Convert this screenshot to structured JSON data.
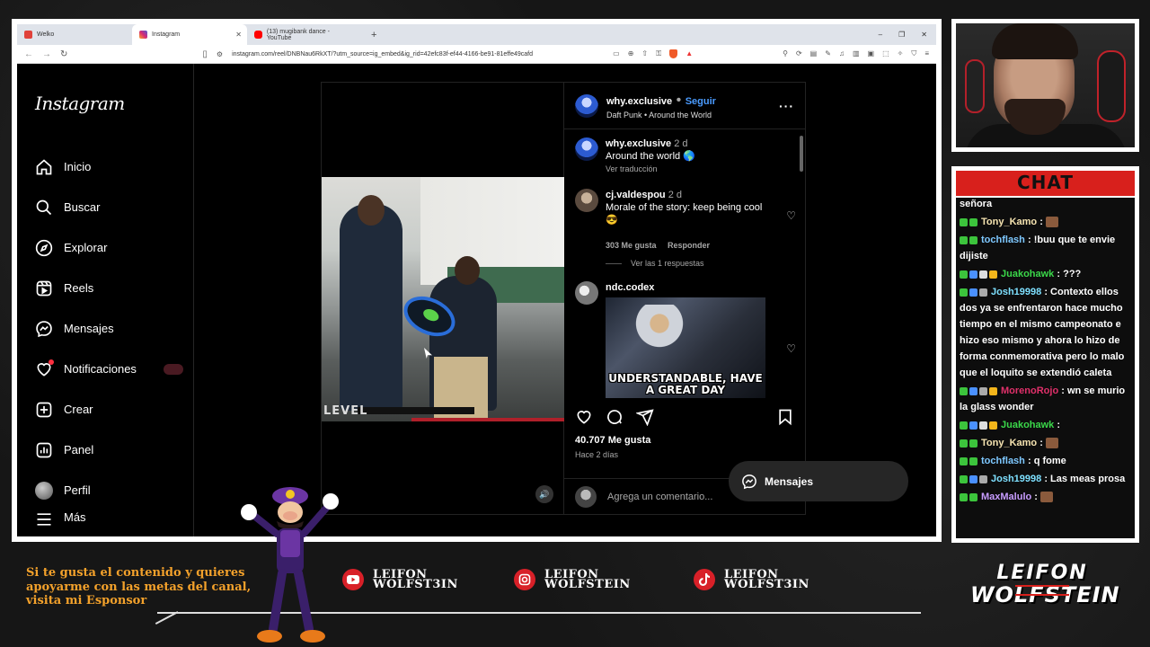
{
  "browser": {
    "tabs": [
      {
        "label": "Welko",
        "active": false,
        "icon": "vivaldi-icon",
        "color": "#e0413a"
      },
      {
        "label": "Instagram",
        "active": true,
        "icon": "instagram-icon",
        "color": "#d62976"
      },
      {
        "label": "(13) mugibank dance - YouTube",
        "active": false,
        "icon": "youtube-icon",
        "color": "#ff0000"
      }
    ],
    "new_tab": "+",
    "url": "instagram.com/reel/DNBNau6RkXT/?utm_source=ig_embed&ig_rid=42efc83f-ef44-4166-be91-81effe49cafd"
  },
  "instagram": {
    "logo": "Instagram",
    "nav": [
      {
        "label": "Inicio",
        "icon": "home-icon"
      },
      {
        "label": "Buscar",
        "icon": "search-icon"
      },
      {
        "label": "Explorar",
        "icon": "compass-icon"
      },
      {
        "label": "Reels",
        "icon": "reels-icon"
      },
      {
        "label": "Mensajes",
        "icon": "messenger-icon"
      },
      {
        "label": "Notificaciones",
        "icon": "heart-icon"
      },
      {
        "label": "Crear",
        "icon": "plus-square-icon"
      },
      {
        "label": "Panel",
        "icon": "chart-icon"
      },
      {
        "label": "Perfil",
        "icon": "avatar-icon"
      },
      {
        "label": "Más",
        "icon": "menu-icon"
      }
    ],
    "post": {
      "video_overlay": "LEVEL",
      "author": "why.exclusive",
      "separator": "•",
      "follow": "Seguir",
      "audio": "Daft Punk • Around the World",
      "caption": {
        "user": "why.exclusive",
        "time": "2 d",
        "text": "Around the world 🌎",
        "translate": "Ver traducción"
      },
      "comments": [
        {
          "user": "cj.valdespou",
          "time": "2 d",
          "text": "Morale of the story: keep being cool 😎",
          "likes": "303 Me gusta",
          "reply": "Responder",
          "view_replies": "Ver las 1 respuestas"
        },
        {
          "user": "ndc.codex",
          "meme_text": "UNDERSTANDABLE, HAVE A GREAT DAY"
        }
      ],
      "likes_total": "40.707 Me gusta",
      "posted_ago": "Hace 2 días",
      "add_comment_placeholder": "Agrega un comentario..."
    },
    "messages_button": "Mensajes"
  },
  "chat": {
    "title": "CHAT",
    "messages": [
      {
        "user": "",
        "text": "señora",
        "color": "#ffffff",
        "badges": []
      },
      {
        "user": "Tony_Kamo",
        "text": ":",
        "color": "#f5e3b0",
        "badges": [
          "#3cc43c",
          "#3cc43c"
        ],
        "emote": true
      },
      {
        "user": "tochflash",
        "text": ": !buu que te envie dijiste",
        "color": "#7ec8ff",
        "badges": [
          "#3cc43c",
          "#3cc43c"
        ]
      },
      {
        "user": "Juakohawk",
        "text": ": ???",
        "color": "#3bd84a",
        "badges": [
          "#3cc43c",
          "#4a90ff",
          "#ddd",
          "#f3b51b"
        ]
      },
      {
        "user": "Josh19998",
        "text": ": Contexto ellos dos ya se enfrentaron hace mucho tiempo en el mismo campeonato e hizo eso mismo y ahora lo hizo de forma conmemorativa pero lo malo que el loquito se extendió caleta",
        "color": "#7ee0ff",
        "badges": [
          "#3cc43c",
          "#4a90ff",
          "#aaa"
        ]
      },
      {
        "user": "MorenoRojo",
        "text": ": wn se murio la glass wonder",
        "color": "#e0306a",
        "badges": [
          "#3cc43c",
          "#4a90ff",
          "#aaa",
          "#f3b51b"
        ]
      },
      {
        "user": "Juakohawk",
        "text": ":",
        "color": "#3bd84a",
        "badges": [
          "#3cc43c",
          "#4a90ff",
          "#ddd",
          "#f3b51b"
        ]
      },
      {
        "user": "Tony_Kamo",
        "text": ":",
        "color": "#f5e3b0",
        "badges": [
          "#3cc43c",
          "#3cc43c"
        ],
        "emote": true
      },
      {
        "user": "tochflash",
        "text": ": q fome",
        "color": "#7ec8ff",
        "badges": [
          "#3cc43c",
          "#3cc43c"
        ]
      },
      {
        "user": "Josh19998",
        "text": ": Las meas prosa",
        "color": "#7ee0ff",
        "badges": [
          "#3cc43c",
          "#4a90ff",
          "#aaa"
        ]
      },
      {
        "user": "MaxMalulo",
        "text": ":",
        "color": "#c89cff",
        "badges": [
          "#3cc43c",
          "#3cc43c"
        ],
        "emote": true
      }
    ]
  },
  "overlay": {
    "sponsor_text": "Si te gusta el contenido y quieres apoyarme con las metas del canal, visita mi Esponsor",
    "socials": [
      {
        "platform": "youtube",
        "icon": "youtube-icon",
        "line1": "LEIFON",
        "line2": "WOLFST3IN"
      },
      {
        "platform": "instagram",
        "icon": "instagram-icon",
        "line1": "LEIFON",
        "line2": "WOLFSTEIN"
      },
      {
        "platform": "tiktok",
        "icon": "tiktok-icon",
        "line1": "LEIFON",
        "line2": "WOLFST3IN"
      }
    ],
    "logo": {
      "line1": "LEIFON",
      "line2": "WOLFSTEIN"
    }
  }
}
